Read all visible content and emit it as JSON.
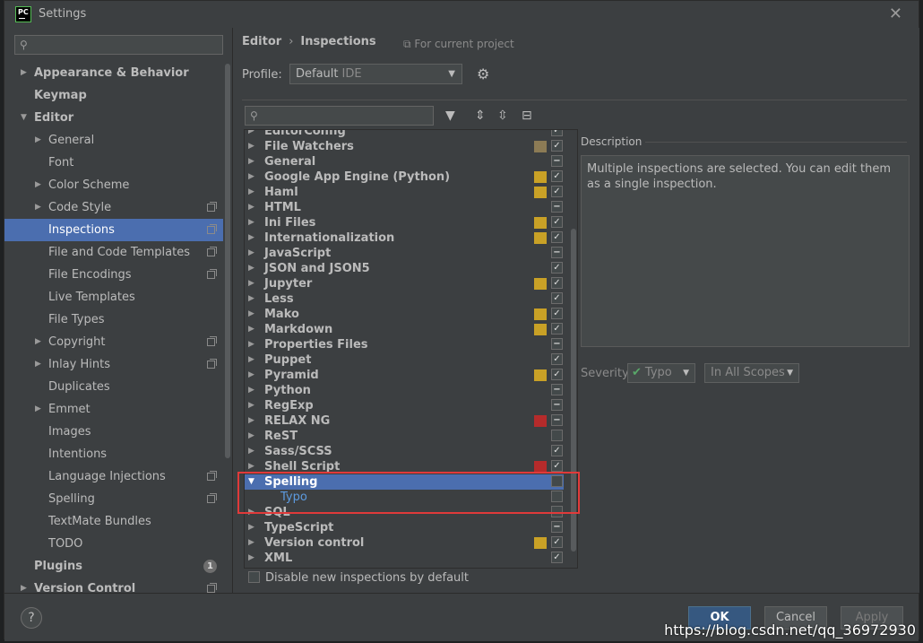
{
  "window": {
    "title": "Settings",
    "app_icon_text": "PC"
  },
  "left_tree": {
    "items": [
      {
        "label": "Appearance & Behavior",
        "level": 0,
        "arrow": "right",
        "bold": true
      },
      {
        "label": "Keymap",
        "level": 0,
        "arrow": "",
        "bold": true
      },
      {
        "label": "Editor",
        "level": 0,
        "arrow": "down",
        "bold": true
      },
      {
        "label": "General",
        "level": 1,
        "arrow": "right"
      },
      {
        "label": "Font",
        "level": 1,
        "arrow": ""
      },
      {
        "label": "Color Scheme",
        "level": 1,
        "arrow": "right"
      },
      {
        "label": "Code Style",
        "level": 1,
        "arrow": "right",
        "copy": true
      },
      {
        "label": "Inspections",
        "level": 1,
        "arrow": "",
        "copy": true,
        "selected": true
      },
      {
        "label": "File and Code Templates",
        "level": 1,
        "arrow": "",
        "copy": true
      },
      {
        "label": "File Encodings",
        "level": 1,
        "arrow": "",
        "copy": true
      },
      {
        "label": "Live Templates",
        "level": 1,
        "arrow": ""
      },
      {
        "label": "File Types",
        "level": 1,
        "arrow": ""
      },
      {
        "label": "Copyright",
        "level": 1,
        "arrow": "right",
        "copy": true
      },
      {
        "label": "Inlay Hints",
        "level": 1,
        "arrow": "right",
        "copy": true
      },
      {
        "label": "Duplicates",
        "level": 1,
        "arrow": ""
      },
      {
        "label": "Emmet",
        "level": 1,
        "arrow": "right"
      },
      {
        "label": "Images",
        "level": 1,
        "arrow": ""
      },
      {
        "label": "Intentions",
        "level": 1,
        "arrow": ""
      },
      {
        "label": "Language Injections",
        "level": 1,
        "arrow": "",
        "copy": true
      },
      {
        "label": "Spelling",
        "level": 1,
        "arrow": "",
        "copy": true
      },
      {
        "label": "TextMate Bundles",
        "level": 1,
        "arrow": ""
      },
      {
        "label": "TODO",
        "level": 1,
        "arrow": ""
      },
      {
        "label": "Plugins",
        "level": 0,
        "arrow": "",
        "bold": true,
        "badge": "1"
      },
      {
        "label": "Version Control",
        "level": 0,
        "arrow": "right",
        "bold": true,
        "copy": true
      }
    ]
  },
  "breadcrumb": {
    "parent": "Editor",
    "separator": "›",
    "current": "Inspections",
    "scope_note": "For current project"
  },
  "profile": {
    "label": "Profile:",
    "value": "Default",
    "tag": "IDE"
  },
  "inspections": {
    "items": [
      {
        "label": "EditorConfig",
        "sev": "",
        "check": "✓"
      },
      {
        "label": "File Watchers",
        "sev": "#8c7b55",
        "check": "✓"
      },
      {
        "label": "General",
        "sev": "",
        "check": "−"
      },
      {
        "label": "Google App Engine (Python)",
        "sev": "#c9a126",
        "check": "✓"
      },
      {
        "label": "Haml",
        "sev": "#c9a126",
        "check": "✓"
      },
      {
        "label": "HTML",
        "sev": "",
        "check": "−"
      },
      {
        "label": "Ini Files",
        "sev": "#c9a126",
        "check": "✓"
      },
      {
        "label": "Internationalization",
        "sev": "#c9a126",
        "check": "✓"
      },
      {
        "label": "JavaScript",
        "sev": "",
        "check": "−"
      },
      {
        "label": "JSON and JSON5",
        "sev": "",
        "check": "✓"
      },
      {
        "label": "Jupyter",
        "sev": "#c9a126",
        "check": "✓"
      },
      {
        "label": "Less",
        "sev": "",
        "check": "✓"
      },
      {
        "label": "Mako",
        "sev": "#c9a126",
        "check": "✓"
      },
      {
        "label": "Markdown",
        "sev": "#c9a126",
        "check": "✓"
      },
      {
        "label": "Properties Files",
        "sev": "",
        "check": "−"
      },
      {
        "label": "Puppet",
        "sev": "",
        "check": "✓"
      },
      {
        "label": "Pyramid",
        "sev": "#c9a126",
        "check": "✓"
      },
      {
        "label": "Python",
        "sev": "",
        "check": "−"
      },
      {
        "label": "RegExp",
        "sev": "",
        "check": "−"
      },
      {
        "label": "RELAX NG",
        "sev": "#b52b2b",
        "check": "−"
      },
      {
        "label": "ReST",
        "sev": "",
        "check": ""
      },
      {
        "label": "Sass/SCSS",
        "sev": "",
        "check": "✓"
      },
      {
        "label": "Shell Script",
        "sev": "#b52b2b",
        "check": "✓"
      },
      {
        "label": "Spelling",
        "sev": "",
        "check": "",
        "selected": true,
        "expanded": true
      },
      {
        "label": "Typo",
        "sev": "",
        "check": "",
        "child": true
      },
      {
        "label": "SQL",
        "sev": "",
        "check": ""
      },
      {
        "label": "TypeScript",
        "sev": "",
        "check": "−"
      },
      {
        "label": "Version control",
        "sev": "#c9a126",
        "check": "✓"
      },
      {
        "label": "XML",
        "sev": "",
        "check": "✓"
      }
    ],
    "disable_new_label": "Disable new inspections by default"
  },
  "description": {
    "label": "Description",
    "text": "Multiple inspections are selected. You can edit them as a single inspection."
  },
  "severity": {
    "label": "Severity:",
    "value": "Typo",
    "scope": "In All Scopes"
  },
  "buttons": {
    "ok": "OK",
    "cancel": "Cancel",
    "apply": "Apply",
    "help": "?"
  },
  "watermark": "https://blog.csdn.net/qq_36972930",
  "colors": {
    "selection": "#4b6eaf",
    "highlight_box": "#e03a3a",
    "ok_button": "#365880"
  }
}
